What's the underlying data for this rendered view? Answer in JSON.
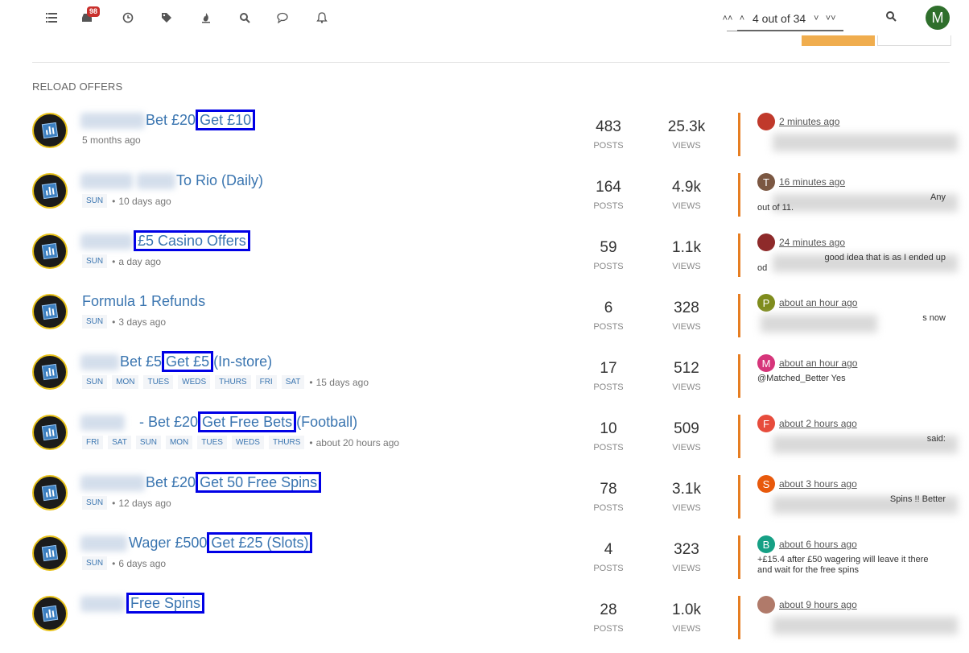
{
  "nav": {
    "notification_count": "98",
    "pager_text": "4 out of 34",
    "user_initial": "M"
  },
  "category_title": "RELOAD OFFERS",
  "stats_labels": {
    "posts": "POSTS",
    "views": "VIEWS"
  },
  "topics": [
    {
      "title_plain": "Bet £20",
      "title_hl": "Get £10",
      "title_suffix": "",
      "tags": [],
      "time": "5 months ago",
      "posts": "483",
      "views": "25.3k",
      "teaser_initial": "",
      "teaser_color": "#c0392b",
      "teaser_time": "2 minutes ago",
      "teaser_text": "",
      "teaser_text2": ""
    },
    {
      "title_plain": "To Rio (Daily)",
      "title_hl": "",
      "title_suffix": "",
      "tags": [
        "SUN"
      ],
      "time": "10 days ago",
      "posts": "164",
      "views": "4.9k",
      "teaser_initial": "T",
      "teaser_color": "#7b5742",
      "teaser_time": "16 minutes ago",
      "teaser_text": "Any",
      "teaser_text2": "out of 11."
    },
    {
      "title_plain": "",
      "title_hl": "£5 Casino Offers",
      "title_suffix": "",
      "tags": [
        "SUN"
      ],
      "time": "a day ago",
      "posts": "59",
      "views": "1.1k",
      "teaser_initial": "",
      "teaser_color": "#8e2a2a",
      "teaser_time": "24 minutes ago",
      "teaser_text": "good idea that is as I ended up",
      "teaser_text2": "od"
    },
    {
      "title_plain": "Formula 1 Refunds",
      "title_hl": "",
      "title_suffix": "",
      "tags": [
        "SUN"
      ],
      "time": "3 days ago",
      "posts": "6",
      "views": "328",
      "teaser_initial": "P",
      "teaser_color": "#7f8c1d",
      "teaser_time": "about an hour ago",
      "teaser_text": "s now",
      "teaser_text2": ""
    },
    {
      "title_plain": "Bet £5",
      "title_hl": "Get £5",
      "title_suffix": "(In-store)",
      "tags": [
        "SUN",
        "MON",
        "TUES",
        "WEDS",
        "THURS",
        "FRI",
        "SAT"
      ],
      "time": "15 days ago",
      "posts": "17",
      "views": "512",
      "teaser_initial": "M",
      "teaser_color": "#d6357a",
      "teaser_time": "about an hour ago",
      "teaser_text": "@Matched_Better Yes",
      "teaser_text2": ""
    },
    {
      "title_plain": "- Bet £20",
      "title_hl": "Get Free Bets",
      "title_suffix": "(Football)",
      "tags": [
        "FRI",
        "SAT",
        "SUN",
        "MON",
        "TUES",
        "WEDS",
        "THURS"
      ],
      "time": "about 20 hours ago",
      "posts": "10",
      "views": "509",
      "teaser_initial": "F",
      "teaser_color": "#e74c3c",
      "teaser_time": "about 2 hours ago",
      "teaser_text": "said:",
      "teaser_text2": ""
    },
    {
      "title_plain": "Bet £20",
      "title_hl": "Get 50 Free Spins",
      "title_suffix": "",
      "tags": [
        "SUN"
      ],
      "time": "12 days ago",
      "posts": "78",
      "views": "3.1k",
      "teaser_initial": "S",
      "teaser_color": "#e8590c",
      "teaser_time": "about 3 hours ago",
      "teaser_text": "Spins !! Better",
      "teaser_text2": ""
    },
    {
      "title_plain": "Wager £500",
      "title_hl": "Get £25 (Slots)",
      "title_suffix": "",
      "tags": [
        "SUN"
      ],
      "time": "6 days ago",
      "posts": "4",
      "views": "323",
      "teaser_initial": "B",
      "teaser_color": "#16a085",
      "teaser_time": "about 6 hours ago",
      "teaser_text": "+£15.4 after £50 wagering will leave it there",
      "teaser_text2": "and wait for the free spins"
    },
    {
      "title_plain": "",
      "title_hl": "Free Spins",
      "title_suffix": "",
      "tags": [],
      "time": "",
      "posts": "28",
      "views": "1.0k",
      "teaser_initial": "",
      "teaser_color": "#b07a6a",
      "teaser_time": "about 9 hours ago",
      "teaser_text": "",
      "teaser_text2": ""
    }
  ]
}
